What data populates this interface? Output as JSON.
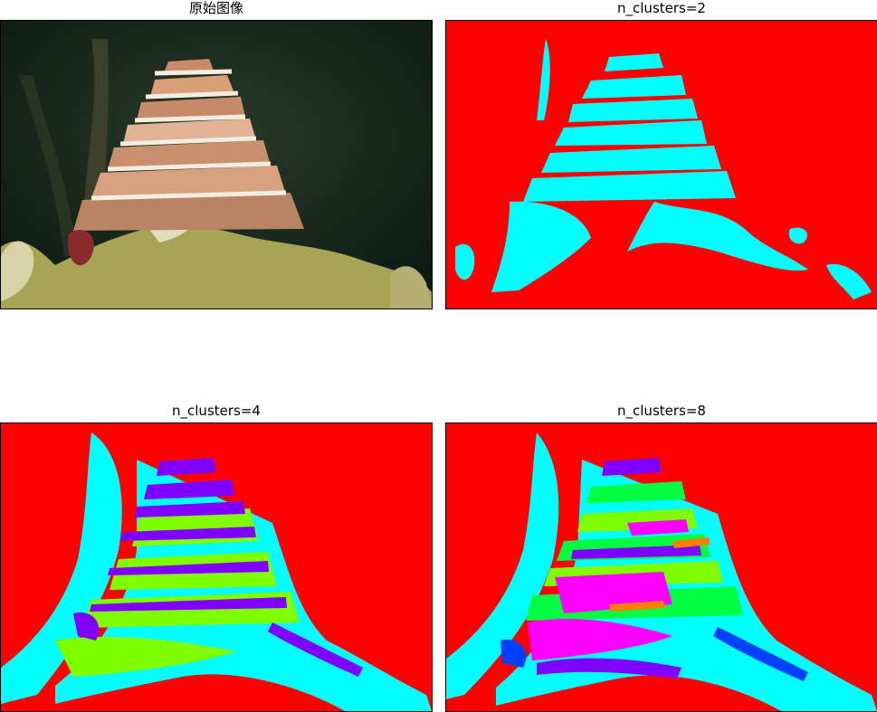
{
  "panels": [
    {
      "title": "原始图像"
    },
    {
      "title": "n_clusters=2"
    },
    {
      "title": "n_clusters=4"
    },
    {
      "title": "n_clusters=8"
    }
  ],
  "colors": {
    "background_cluster": "#ff0000",
    "cyan_cluster": "#00ffff",
    "green_cluster": "#80ff00",
    "violet_cluster": "#8000ff",
    "magenta_cluster": "#ff00ff",
    "blue_cluster": "#0040ff",
    "orange_cluster": "#ff8000",
    "lime_cluster": "#00ff40"
  }
}
